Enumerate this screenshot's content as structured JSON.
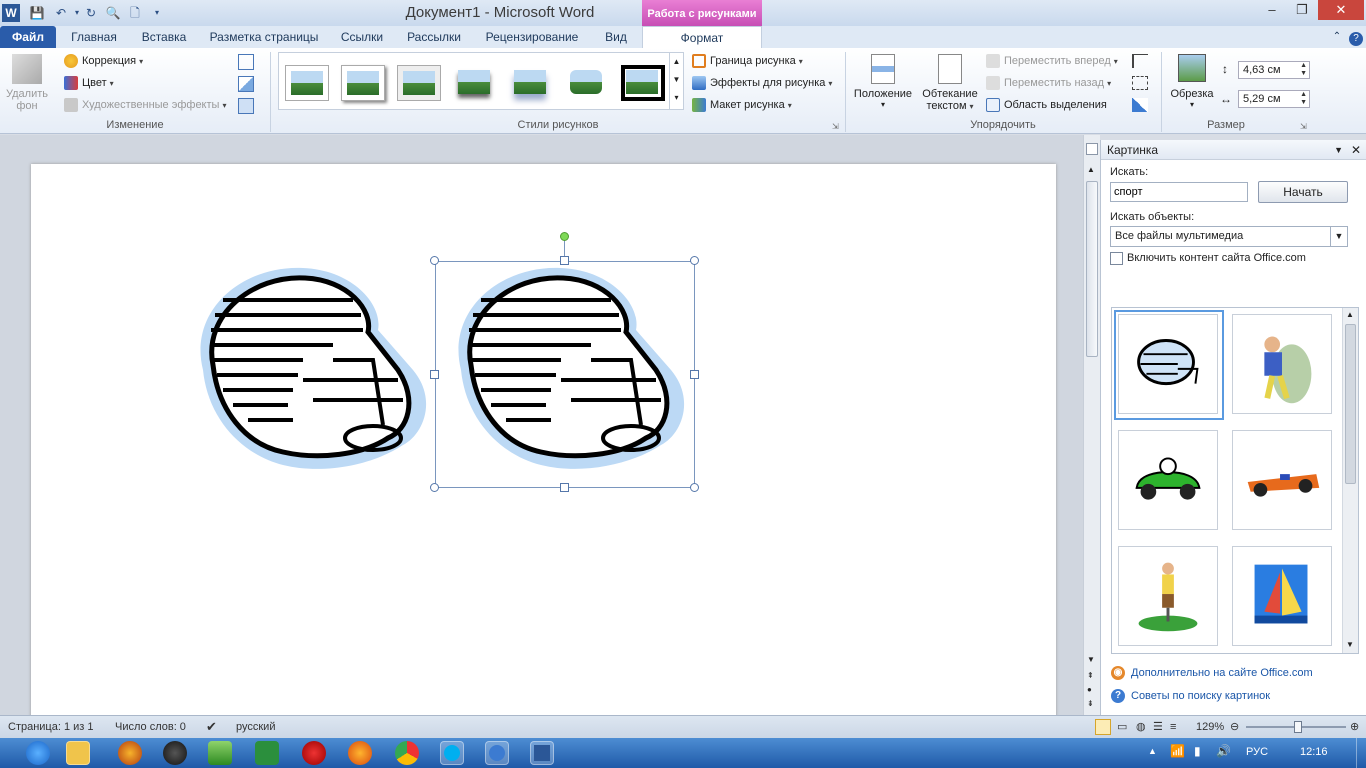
{
  "window": {
    "title": "Документ1 - Microsoft Word",
    "context_group": "Работа с рисунками",
    "app_icon": "W",
    "controls": {
      "minimize": "–",
      "restore": "❐",
      "close": "✕"
    }
  },
  "tabs": [
    {
      "label": "Файл"
    },
    {
      "label": "Главная"
    },
    {
      "label": "Вставка"
    },
    {
      "label": "Разметка страницы"
    },
    {
      "label": "Ссылки"
    },
    {
      "label": "Рассылки"
    },
    {
      "label": "Рецензирование"
    },
    {
      "label": "Вид"
    },
    {
      "label": "Формат"
    }
  ],
  "ribbon": {
    "adjust": {
      "remove_bg": "Удалить фон",
      "correction": "Коррекция",
      "color": "Цвет",
      "artistic": "Художественные эффекты",
      "group_label": "Изменение"
    },
    "styles": {
      "group_label": "Стили рисунков",
      "border": "Граница рисунка",
      "effects": "Эффекты для рисунка",
      "layout": "Макет рисунка"
    },
    "arrange": {
      "position": "Положение",
      "wrap_line1": "Обтекание",
      "wrap_line2": "текстом",
      "bring_forward": "Переместить вперед",
      "send_backward": "Переместить назад",
      "selection_pane": "Область выделения",
      "group_label": "Упорядочить"
    },
    "size": {
      "crop": "Обрезка",
      "height": "4,63 см",
      "width": "5,29 см",
      "group_label": "Размер"
    }
  },
  "pane": {
    "title": "Картинка",
    "search_label": "Искать:",
    "search_value": "спорт",
    "search_button": "Начать",
    "objects_label": "Искать объекты:",
    "objects_value": "Все файлы мультимедиа",
    "include_label": "Включить контент сайта Office.com",
    "link_more": "Дополнительно на сайте Office.com",
    "link_tips": "Советы по поиску картинок"
  },
  "status": {
    "page": "Страница: 1 из 1",
    "words": "Число слов: 0",
    "language": "русский",
    "zoom": "129%"
  },
  "tray": {
    "lang": "РУС",
    "time": "12:16"
  },
  "colors": {
    "accent": "#2a5caa",
    "context_tab": "#c44ab2",
    "taskbar": "#2a68b8"
  }
}
